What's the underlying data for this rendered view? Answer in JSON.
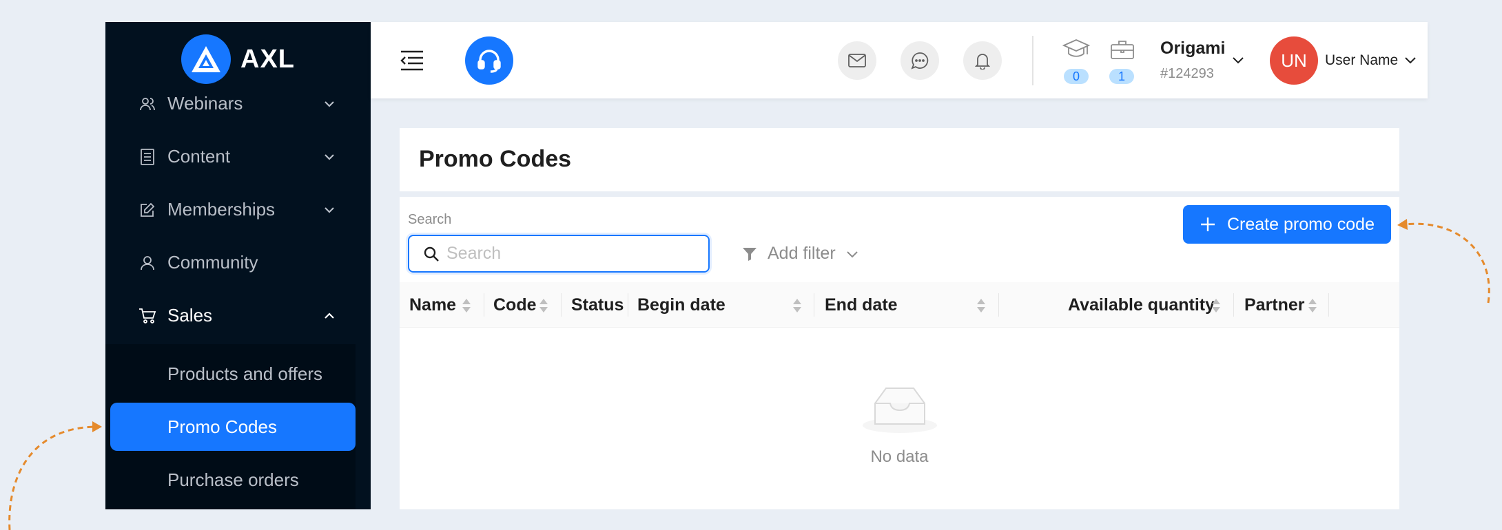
{
  "app": {
    "name": "AXL"
  },
  "sidebar": {
    "items": [
      {
        "label": "Webinars"
      },
      {
        "label": "Content"
      },
      {
        "label": "Memberships"
      },
      {
        "label": "Community"
      },
      {
        "label": "Sales"
      }
    ],
    "sales_sub": [
      {
        "label": "Products and offers"
      },
      {
        "label": "Promo Codes"
      },
      {
        "label": "Purchase orders"
      }
    ]
  },
  "header": {
    "courses_count": "0",
    "jobs_count": "1",
    "org_name": "Origami",
    "org_id": "#124293",
    "user_initials": "UN",
    "user_name": "User Name"
  },
  "page": {
    "title": "Promo Codes",
    "search_label": "Search",
    "search_placeholder": "Search",
    "search_value": "",
    "add_filter_label": "Add filter",
    "create_button_label": "Create promo code"
  },
  "table": {
    "columns": [
      "Name",
      "Code",
      "Status",
      "Begin date",
      "End date",
      "Available quantity",
      "Partner"
    ],
    "empty_text": "No data"
  },
  "colors": {
    "accent": "#1677ff",
    "sidebar_bg": "#02111f",
    "avatar_bg": "#e74c3c",
    "annotation_arrow": "#e58a2c"
  }
}
